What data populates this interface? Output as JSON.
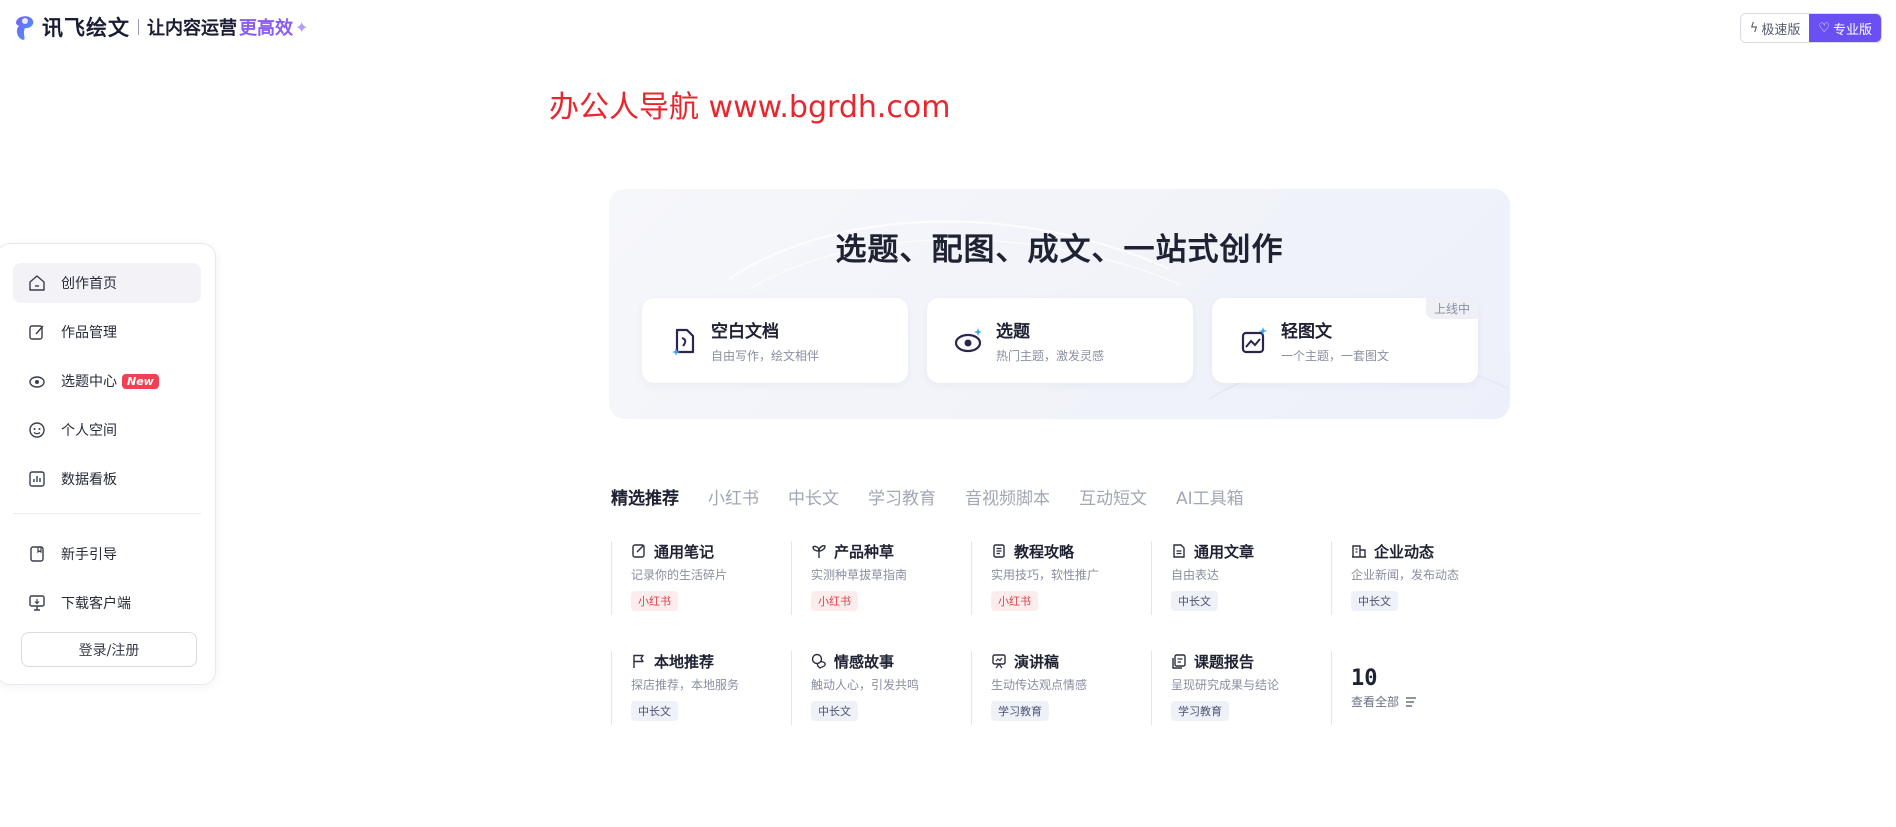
{
  "header": {
    "brand_name": "讯飞绘文",
    "slogan": "让内容运营",
    "slogan_highlight": "更高效",
    "version_fast": "极速版",
    "version_pro": "专业版",
    "accent_color": "#6a4ff2"
  },
  "watermark": "办公人导航  www.bgrdh.com",
  "sidebar": {
    "items": [
      {
        "label": "创作首页",
        "icon": "home-icon"
      },
      {
        "label": "作品管理",
        "icon": "edit-icon"
      },
      {
        "label": "选题中心",
        "icon": "eye-icon",
        "badge": "New"
      },
      {
        "label": "个人空间",
        "icon": "face-icon"
      },
      {
        "label": "数据看板",
        "icon": "chart-icon"
      }
    ],
    "secondary": [
      {
        "label": "新手引导",
        "icon": "book-icon"
      },
      {
        "label": "下载客户端",
        "icon": "monitor-icon"
      }
    ],
    "login": "登录/注册"
  },
  "hero": {
    "title": "选题、配图、成文、一站式创作",
    "cards": [
      {
        "title": "空白文档",
        "subtitle": "自由写作，绘文相伴",
        "icon": "blank-doc-icon"
      },
      {
        "title": "选题",
        "subtitle": "热门主题，激发灵感",
        "icon": "topic-eye-icon"
      },
      {
        "title": "轻图文",
        "subtitle": "一个主题，一套图文",
        "icon": "image-text-icon",
        "tag": "上线中"
      }
    ]
  },
  "tabs": [
    "精选推荐",
    "小红书",
    "中长文",
    "学习教育",
    "音视频脚本",
    "互动短文",
    "AI工具箱"
  ],
  "templates": [
    {
      "title": "通用笔记",
      "desc": "记录你的生活碎片",
      "tag": "小红书",
      "tag_color": "red",
      "icon": "note-icon"
    },
    {
      "title": "产品种草",
      "desc": "实测种草拔草指南",
      "tag": "小红书",
      "tag_color": "red",
      "icon": "sprout-icon"
    },
    {
      "title": "教程攻略",
      "desc": "实用技巧，软性推广",
      "tag": "小红书",
      "tag_color": "red",
      "icon": "guide-icon"
    },
    {
      "title": "通用文章",
      "desc": "自由表达",
      "tag": "中长文",
      "tag_color": "blue",
      "icon": "article-icon"
    },
    {
      "title": "企业动态",
      "desc": "企业新闻，发布动态",
      "tag": "中长文",
      "tag_color": "blue",
      "icon": "building-icon"
    },
    {
      "title": "本地推荐",
      "desc": "探店推荐，本地服务",
      "tag": "中长文",
      "tag_color": "blue",
      "icon": "flag-icon"
    },
    {
      "title": "情感故事",
      "desc": "触动人心，引发共鸣",
      "tag": "中长文",
      "tag_color": "blue",
      "icon": "heart-chat-icon"
    },
    {
      "title": "演讲稿",
      "desc": "生动传达观点情感",
      "tag": "学习教育",
      "tag_color": "blue",
      "icon": "presentation-icon"
    },
    {
      "title": "课题报告",
      "desc": "呈现研究成果与结论",
      "tag": "学习教育",
      "tag_color": "blue",
      "icon": "report-icon"
    }
  ],
  "more": {
    "count": "10",
    "label": "查看全部"
  }
}
